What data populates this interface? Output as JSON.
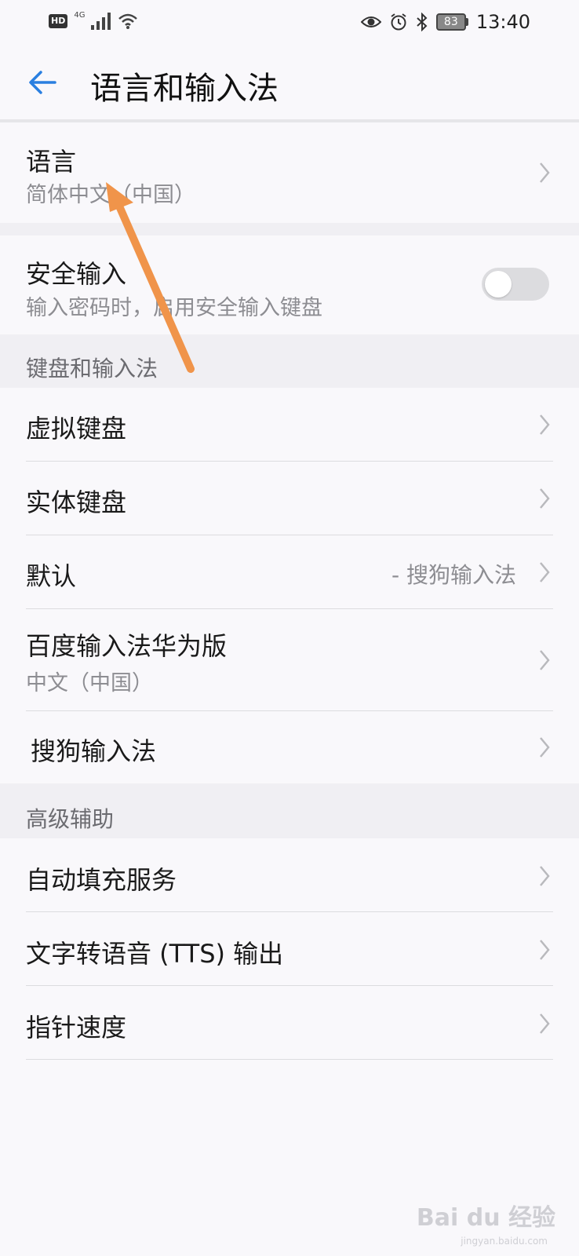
{
  "status_bar": {
    "hd": "HD",
    "network": "4G",
    "battery": "83",
    "time": "13:40",
    "icons": [
      "eye-icon",
      "alarm-icon",
      "bluetooth-icon"
    ]
  },
  "app_bar": {
    "title": "语言和输入法"
  },
  "language": {
    "title": "语言",
    "subtitle": "简体中文（中国）"
  },
  "secure_input": {
    "title": "安全输入",
    "subtitle": "输入密码时，启用安全输入键盘",
    "enabled": false
  },
  "keyboard_section": {
    "label": "键盘和输入法",
    "items": [
      {
        "title": "虚拟键盘"
      },
      {
        "title": "实体键盘"
      },
      {
        "title": "默认",
        "value": "- 搜狗输入法"
      },
      {
        "title": "百度输入法华为版",
        "subtitle": "中文（中国）"
      },
      {
        "title": "搜狗输入法"
      }
    ]
  },
  "advanced_section": {
    "label": "高级辅助",
    "items": [
      {
        "title": "自动填充服务"
      },
      {
        "title": "文字转语音 (TTS) 输出"
      },
      {
        "title": "指针速度"
      }
    ]
  },
  "watermark": {
    "text": "Bai du 经验",
    "sub": "jingyan.baidu.com"
  },
  "colors": {
    "accent": "#2a7fe0",
    "annotation_arrow": "#f0944a"
  }
}
